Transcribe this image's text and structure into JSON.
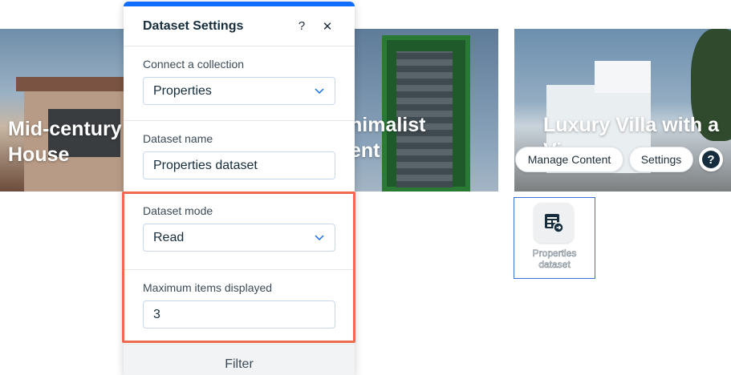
{
  "gallery": {
    "cards": [
      {
        "title": "Mid-century\nHouse"
      },
      {
        "title": "nimalist\nent"
      },
      {
        "title": "Luxury Villa with a\nVi"
      }
    ]
  },
  "toolbar": {
    "manage_content_label": "Manage Content",
    "settings_label": "Settings",
    "help_label": "?"
  },
  "dataset_element": {
    "label": "Properties\ndataset"
  },
  "panel": {
    "title": "Dataset Settings",
    "help_glyph": "?",
    "close_glyph": "✕",
    "collection": {
      "label": "Connect a collection",
      "value": "Properties"
    },
    "name": {
      "label": "Dataset name",
      "value": "Properties dataset"
    },
    "mode": {
      "label": "Dataset mode",
      "value": "Read"
    },
    "max_items": {
      "label": "Maximum items displayed",
      "value": "3"
    },
    "filter_label": "Filter"
  },
  "colors": {
    "accent": "#116dff",
    "highlight": "#f06a4f",
    "text_dark": "#162d3d"
  },
  "icons": [
    "help-icon",
    "close-icon",
    "chevron-down-icon",
    "dataset-icon"
  ]
}
